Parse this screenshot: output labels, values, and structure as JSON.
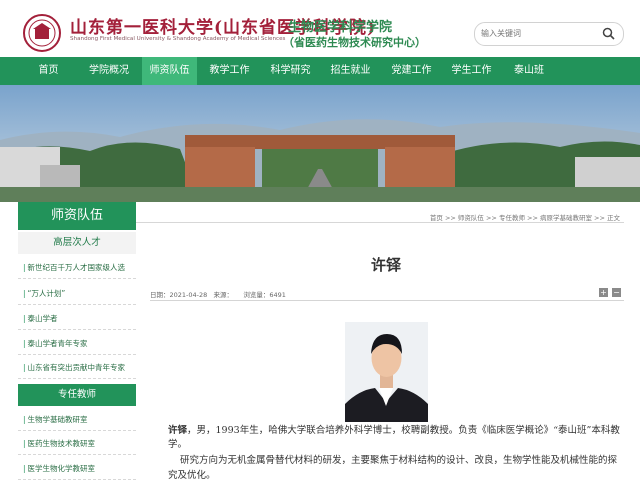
{
  "header": {
    "school_name_cn": "山东第一医科大学(山东省医学科学院)",
    "school_name_en": "Shandong First Medical University & Shandong Academy of Medical Sciences",
    "college_name": "生物医学科学学院",
    "college_subtitle": "（省医药生物技术研究中心）",
    "search_placeholder": "输入关键词"
  },
  "nav": {
    "items": [
      "首页",
      "学院概况",
      "师资队伍",
      "教学工作",
      "科学研究",
      "招生就业",
      "党建工作",
      "学生工作",
      "泰山班"
    ],
    "active": "师资队伍"
  },
  "sidebar": {
    "title": "师资队伍",
    "group1": "高层次人才",
    "group1_items": [
      "新世纪百千万人才国家级人选",
      "“万人计划”",
      "泰山学者",
      "泰山学者青年专家",
      "山东省有突出贡献中青年专家"
    ],
    "group2": "专任教师",
    "group2_items": [
      "生物学基础教研室",
      "医药生物技术教研室",
      "医学生物化学教研室"
    ]
  },
  "breadcrumb": "首页 >> 师资队伍 >> 专任教师 >> 病原学基础教研室 >> 正文",
  "article": {
    "title": "许铎",
    "date": "日期：2021-04-28",
    "source": "来源：",
    "views": "浏览量：6491",
    "font_increase": "+",
    "font_decrease": "−",
    "bio_name": "许铎",
    "bio_text": "，男，1993年生，哈佛大学联合培养外科学博士，校聘副教授。负责《临床医学概论》“泰山班”本科教学。",
    "bio_text2": "研究方向为无机金属骨替代材料的研发，主要聚焦于材料结构的设计、改良，生物学性能及机械性能的探究及优化。"
  },
  "colors": {
    "nav_green": "#22935a",
    "nav_active": "#3fb87a",
    "school_red": "#a3203a",
    "college_green": "#2e8a52"
  }
}
